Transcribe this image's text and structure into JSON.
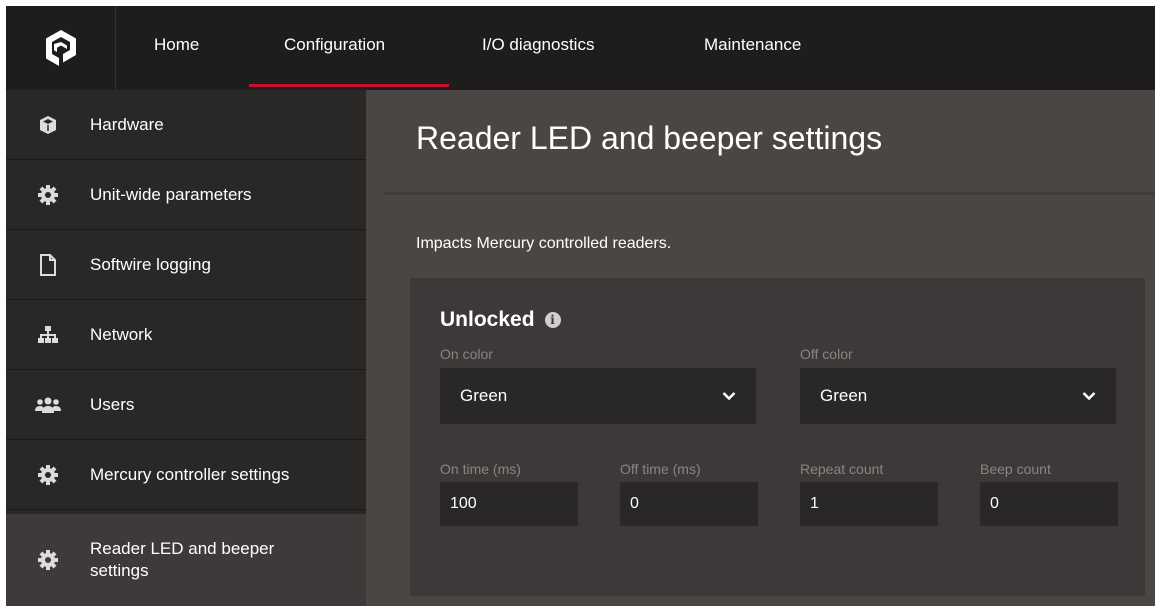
{
  "nav": {
    "items": [
      {
        "label": "Home"
      },
      {
        "label": "Configuration"
      },
      {
        "label": "I/O diagnostics"
      },
      {
        "label": "Maintenance"
      }
    ],
    "active": "Configuration",
    "accent_color": "#c8102e"
  },
  "sidebar": {
    "items": [
      {
        "label": "Hardware",
        "icon": "cube-icon"
      },
      {
        "label": "Unit-wide parameters",
        "icon": "gear-icon"
      },
      {
        "label": "Softwire logging",
        "icon": "document-icon"
      },
      {
        "label": "Network",
        "icon": "network-icon"
      },
      {
        "label": "Users",
        "icon": "users-icon"
      },
      {
        "label": "Mercury controller settings",
        "icon": "gear-icon"
      },
      {
        "label_line1": "Reader LED and beeper",
        "label_line2": "settings",
        "icon": "gear-icon"
      }
    ],
    "active_index": 6
  },
  "main": {
    "title": "Reader LED and beeper settings",
    "description": "Impacts Mercury controlled readers.",
    "panel": {
      "title": "Unlocked",
      "info_icon": "info-icon",
      "on_color": {
        "label": "On color",
        "value": "Green"
      },
      "off_color": {
        "label": "Off color",
        "value": "Green"
      },
      "on_time": {
        "label": "On time (ms)",
        "value": "100"
      },
      "off_time": {
        "label": "Off time (ms)",
        "value": "0"
      },
      "repeat_count": {
        "label": "Repeat count",
        "value": "1"
      },
      "beep_count": {
        "label": "Beep count",
        "value": "0"
      }
    }
  }
}
